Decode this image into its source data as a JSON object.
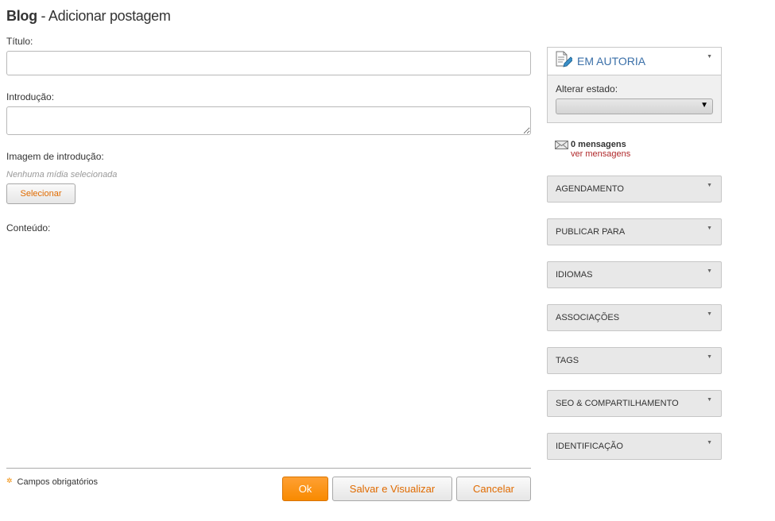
{
  "header": {
    "title_bold": "Blog",
    "title_rest": " - Adicionar postagem"
  },
  "form": {
    "title_label": "Título:",
    "title_value": "",
    "intro_label": "Introdução:",
    "intro_value": "",
    "image_label": "Imagem de introdução:",
    "image_hint": "Nenhuma mídia selecionada",
    "select_button": "Selecionar",
    "content_label": "Conteúdo:"
  },
  "footer": {
    "required_label": "Campos obrigatórios",
    "ok_button": "Ok",
    "save_preview_button": "Salvar e Visualizar",
    "cancel_button": "Cancelar"
  },
  "sidebar": {
    "authoring": {
      "title": "EM AUTORIA",
      "state_label": "Alterar estado:",
      "state_value": ""
    },
    "messages": {
      "count": "0 mensagens",
      "link": "ver mensagens"
    },
    "sections": [
      {
        "label": "AGENDAMENTO"
      },
      {
        "label": "PUBLICAR PARA"
      },
      {
        "label": "IDIOMAS"
      },
      {
        "label": "ASSOCIAÇÕES"
      },
      {
        "label": "TAGS"
      },
      {
        "label": "SEO & COMPARTILHAMENTO"
      },
      {
        "label": "IDENTIFICAÇÃO"
      }
    ]
  },
  "colors": {
    "accent": "#f88a00",
    "link": "#b0282a",
    "panel_title": "#3a6fa8"
  }
}
